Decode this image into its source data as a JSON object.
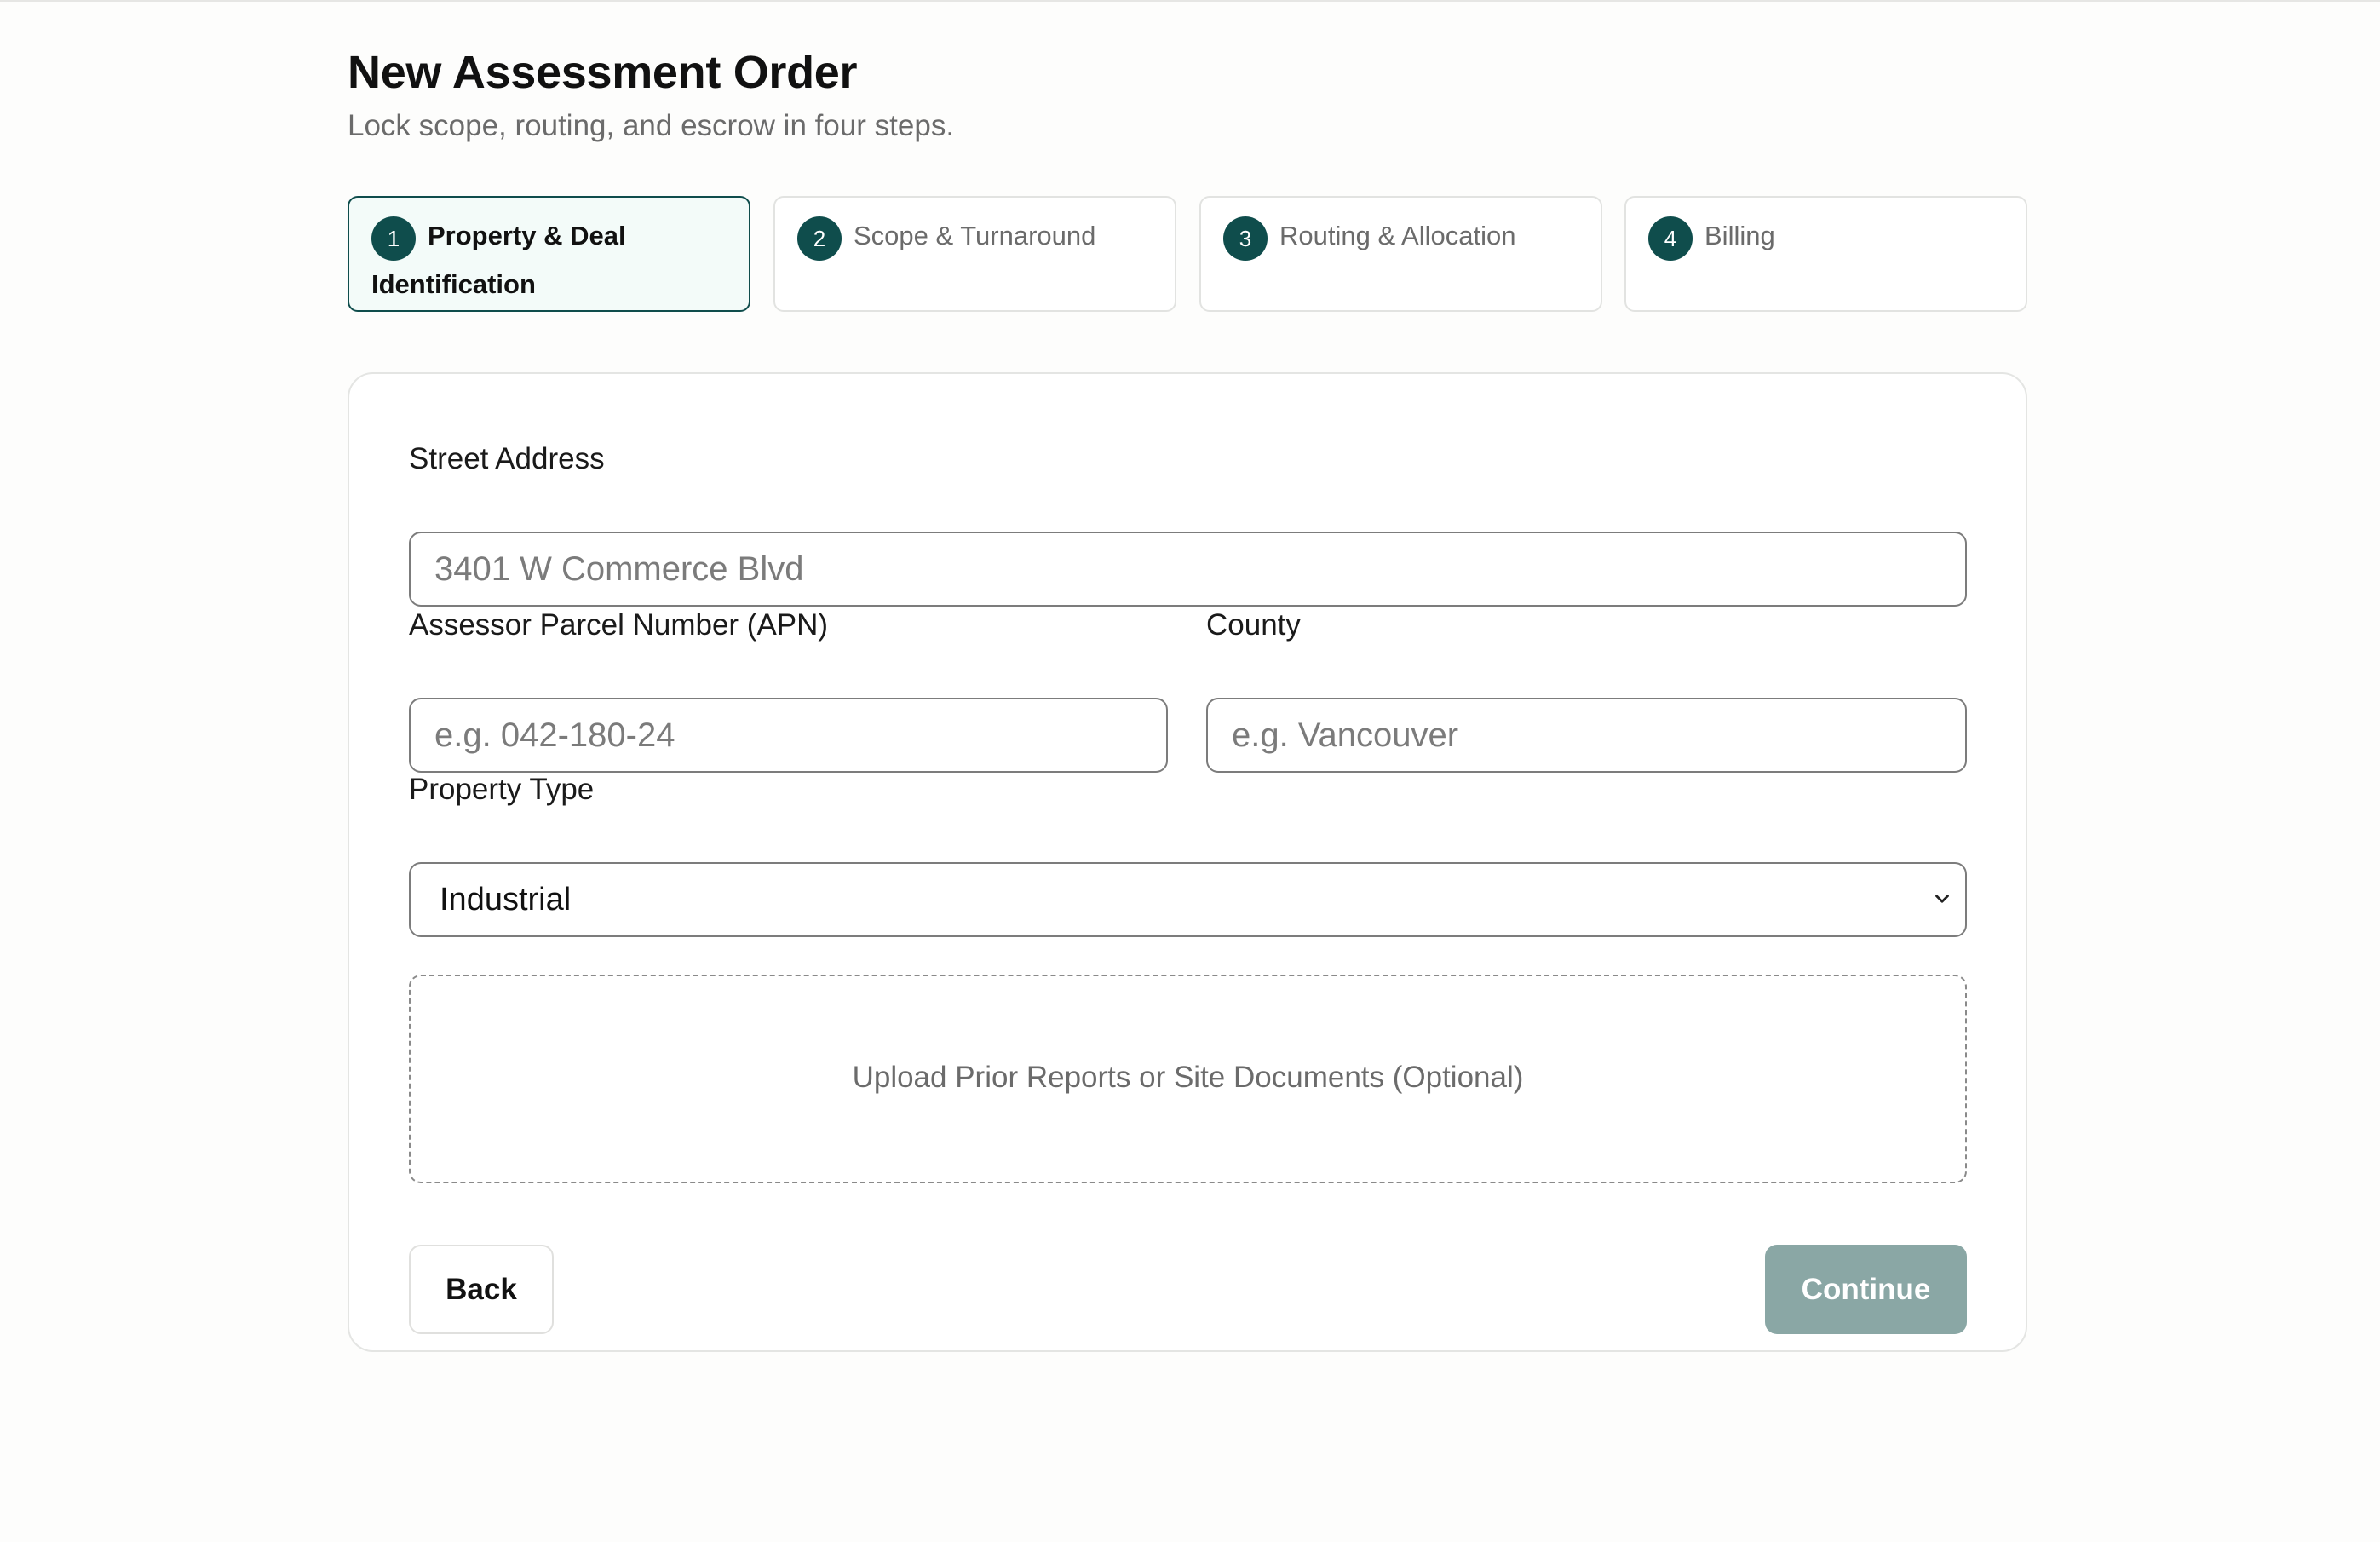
{
  "header": {
    "title": "New Assessment Order",
    "subtitle": "Lock scope, routing, and escrow in four steps."
  },
  "steps": [
    {
      "number": "1",
      "label": "Property & Deal Identification",
      "active": true
    },
    {
      "number": "2",
      "label": "Scope & Turnaround",
      "active": false
    },
    {
      "number": "3",
      "label": "Routing & Allocation",
      "active": false
    },
    {
      "number": "4",
      "label": "Billing",
      "active": false
    }
  ],
  "form": {
    "street_address": {
      "label": "Street Address",
      "value": "",
      "placeholder": "3401 W Commerce Blvd"
    },
    "apn": {
      "label": "Assessor Parcel Number (APN)",
      "value": "",
      "placeholder": "e.g. 042-180-24"
    },
    "county": {
      "label": "County",
      "value": "",
      "placeholder": "e.g. Vancouver"
    },
    "property_type": {
      "label": "Property Type",
      "selected": "Industrial"
    },
    "upload": {
      "label": "Upload Prior Reports or Site Documents (Optional)"
    }
  },
  "actions": {
    "back_label": "Back",
    "continue_label": "Continue"
  },
  "colors": {
    "accent": "#0f4d4c",
    "active_step_bg": "#f3fbf9",
    "continue_disabled": "#8aa7a5"
  },
  "icons": {
    "select_chevron": "chevron-down-icon"
  }
}
